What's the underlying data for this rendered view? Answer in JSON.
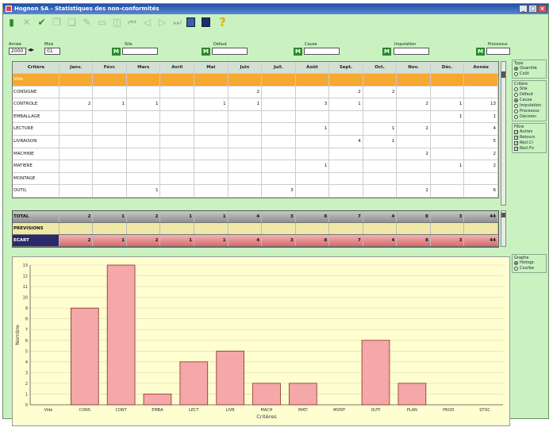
{
  "window": {
    "title": "Hognon SA - Statistiques des non-conformités"
  },
  "toolbar": {
    "icons": [
      "exit-icon",
      "cancel-icon",
      "check-icon",
      "copy-icon",
      "paste-icon",
      "edit-icon",
      "delete-icon",
      "duplicate-icon",
      "first-icon",
      "prev-icon",
      "next-icon",
      "last-icon",
      "print-icon",
      "preview-icon",
      "help-icon"
    ]
  },
  "filters": {
    "annee_label": "Année",
    "annee_value": "2000",
    "mois_label": "Mois",
    "mois_value": "01",
    "site_label": "Site",
    "defaut_label": "Défaut",
    "cause_label": "Cause",
    "imputation_label": "Imputation",
    "processus_label": "Processus"
  },
  "grid": {
    "headers": [
      "Critère",
      "Janv.",
      "Févr.",
      "Mars",
      "Avril",
      "Mai",
      "Juin",
      "Juil.",
      "Août",
      "Sept.",
      "Oct.",
      "Nov.",
      "Déc.",
      "Année"
    ],
    "rows": [
      {
        "label": "Vide",
        "values": [
          "",
          "",
          "",
          "",
          "",
          "",
          "",
          "",
          "",
          "",
          "",
          "",
          ""
        ]
      },
      {
        "label": "CONSIGNE",
        "values": [
          "",
          "",
          "",
          "",
          "",
          "2",
          "",
          "",
          "2",
          "2",
          "",
          "",
          ""
        ]
      },
      {
        "label": "CONTROLE",
        "values": [
          "2",
          "1",
          "1",
          "",
          "1",
          "1",
          "",
          "3",
          "1",
          "",
          "2",
          "1",
          "13"
        ]
      },
      {
        "label": "EMBALLAGE",
        "values": [
          "",
          "",
          "",
          "",
          "",
          "",
          "",
          "",
          "",
          "",
          "",
          "1",
          "1"
        ]
      },
      {
        "label": "LECTURE",
        "values": [
          "",
          "",
          "",
          "",
          "",
          "",
          "",
          "1",
          "",
          "1",
          "2",
          "",
          "4"
        ]
      },
      {
        "label": "LIVRAISON",
        "values": [
          "",
          "",
          "",
          "",
          "",
          "",
          "",
          "",
          "4",
          "1",
          "",
          "",
          "5"
        ]
      },
      {
        "label": "MACHINE",
        "values": [
          "",
          "",
          "",
          "",
          "",
          "",
          "",
          "",
          "",
          "",
          "2",
          "",
          "2"
        ]
      },
      {
        "label": "MATIERE",
        "values": [
          "",
          "",
          "",
          "",
          "",
          "",
          "",
          "1",
          "",
          "",
          "",
          "1",
          "2"
        ]
      },
      {
        "label": "MONTAGE",
        "values": [
          "",
          "",
          "",
          "",
          "",
          "",
          "",
          "",
          "",
          "",
          "",
          "",
          ""
        ]
      },
      {
        "label": "OUTIL",
        "values": [
          "",
          "",
          "1",
          "",
          "",
          "",
          "3",
          "",
          "",
          "",
          "2",
          "",
          "6"
        ]
      }
    ]
  },
  "totals": {
    "total": {
      "label": "TOTAL",
      "values": [
        "2",
        "1",
        "2",
        "1",
        "1",
        "4",
        "3",
        "8",
        "7",
        "4",
        "8",
        "3",
        "44"
      ]
    },
    "previsions": {
      "label": "PREVISIONS",
      "values": [
        "",
        "",
        "",
        "",
        "",
        "",
        "",
        "",
        "",
        "",
        "",
        "",
        ""
      ]
    },
    "ecart": {
      "label": "ECART",
      "values": [
        "2",
        "1",
        "2",
        "1",
        "1",
        "4",
        "3",
        "8",
        "7",
        "4",
        "8",
        "3",
        "44"
      ]
    }
  },
  "side": {
    "type_title": "Type",
    "type_options": [
      {
        "label": "Quantité",
        "on": true
      },
      {
        "label": "Coût",
        "on": false
      }
    ],
    "critere_title": "Critère",
    "critere_options": [
      {
        "label": "Site",
        "on": false
      },
      {
        "label": "Défaut",
        "on": false
      },
      {
        "label": "Cause",
        "on": true
      },
      {
        "label": "Imputation",
        "on": false
      },
      {
        "label": "Processus",
        "on": false
      },
      {
        "label": "Décision",
        "on": false
      }
    ],
    "filtre_title": "Filtre",
    "filtre_options": [
      {
        "label": "Autres",
        "on": true
      },
      {
        "label": "Retours",
        "on": true
      },
      {
        "label": "Récl.Cl",
        "on": true
      },
      {
        "label": "Récl.Fo",
        "on": true
      }
    ],
    "graphe_title": "Graphe",
    "graphe_options": [
      {
        "label": "Histogr.",
        "on": true
      },
      {
        "label": "Courbe",
        "on": false
      }
    ]
  },
  "chart_data": {
    "type": "bar",
    "categories": [
      "Vide",
      "CONS",
      "CONT",
      "EMBA",
      "LECT",
      "LIVR",
      "MACH",
      "MATI",
      "MONT",
      "OUTI",
      "PLAN",
      "PROD",
      "STOC"
    ],
    "values": [
      0,
      9,
      13,
      1,
      4,
      5,
      2,
      2,
      0,
      6,
      2,
      0,
      0
    ],
    "xlabel": "Critères",
    "ylabel": "Nombre",
    "ylim": [
      0,
      13
    ],
    "bar_color": "#f4a8a8",
    "bg_color": "#fffed0"
  }
}
